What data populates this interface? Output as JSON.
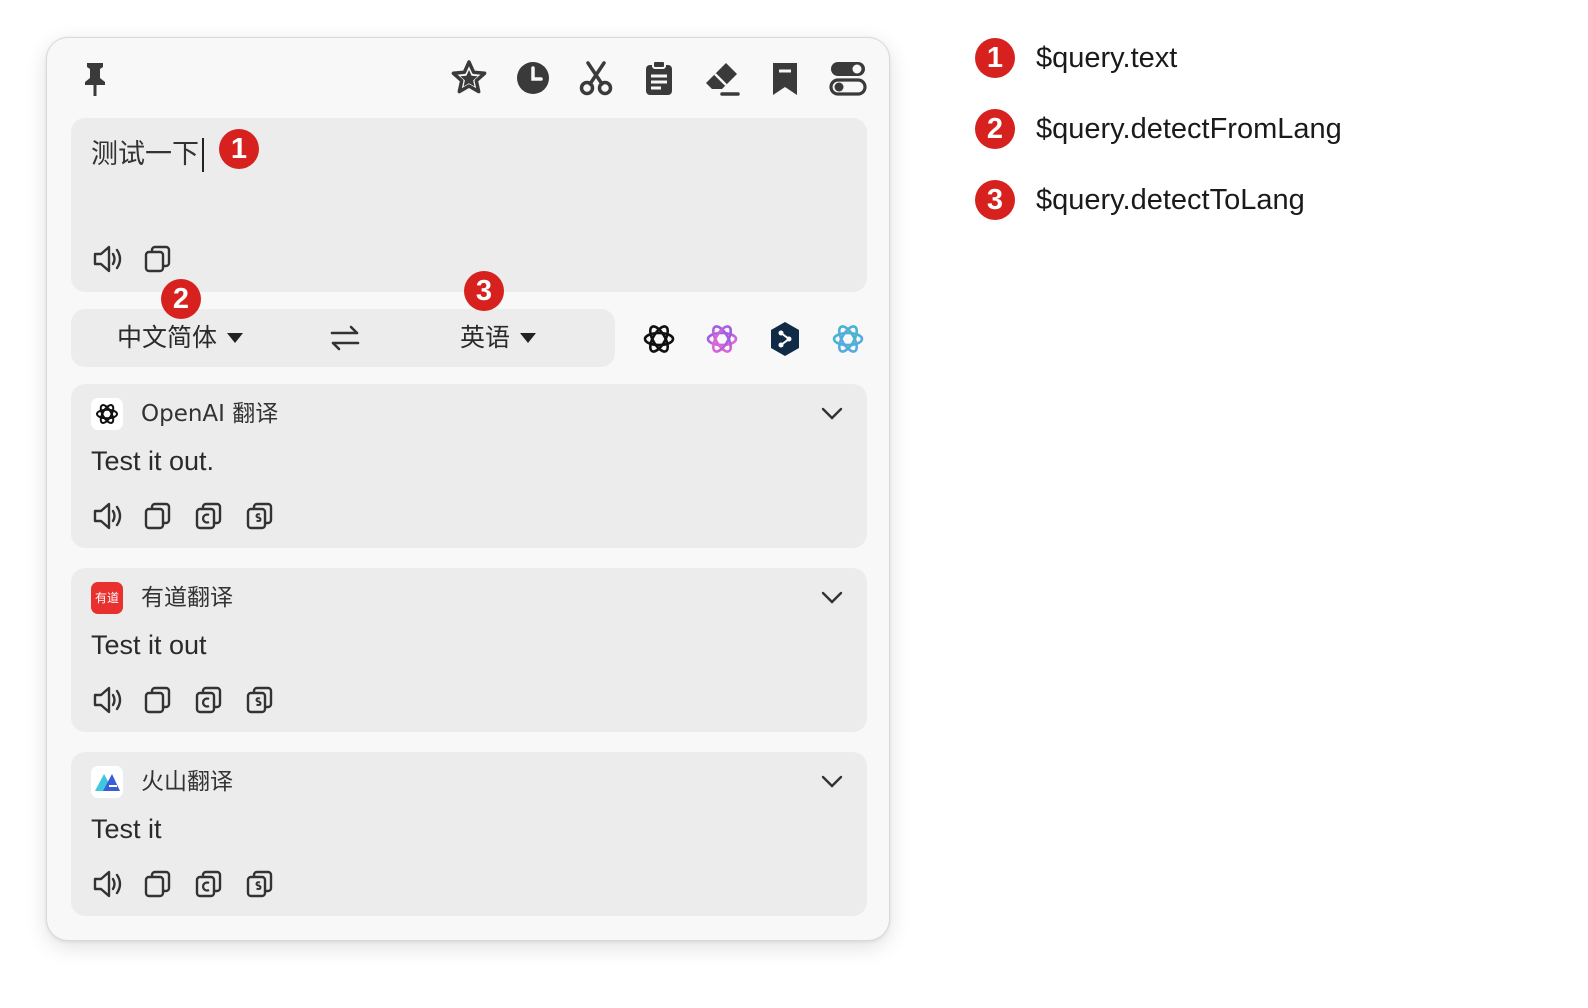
{
  "input": {
    "text": "测试一下"
  },
  "languages": {
    "from": "中文简体",
    "to": "英语"
  },
  "toolbar": {
    "icons": [
      "pin-icon",
      "star-icon",
      "history-icon",
      "scissors-icon",
      "clipboard-icon",
      "eraser-icon",
      "bookmark-icon",
      "toggle-icon"
    ]
  },
  "services": [
    "openai-logo",
    "openai-gradient-logo",
    "deepl-logo",
    "openai-teal-logo"
  ],
  "results": [
    {
      "name": "OpenAI 翻译",
      "text": "Test it out.",
      "logo": "openai-logo"
    },
    {
      "name": "有道翻译",
      "text": "Test it out",
      "logo": "youdao-logo"
    },
    {
      "name": "火山翻译",
      "text": "Test it",
      "logo": "volcano-logo"
    }
  ],
  "youdao_logo_text": "有道",
  "annotations": [
    {
      "number": "1",
      "label": "$query.text"
    },
    {
      "number": "2",
      "label": "$query.detectFromLang"
    },
    {
      "number": "3",
      "label": "$query.detectToLang"
    }
  ],
  "colors": {
    "badge": "#d7211f",
    "panel": "#ececec",
    "window": "#f8f8f8",
    "youdao": "#e8302e"
  }
}
